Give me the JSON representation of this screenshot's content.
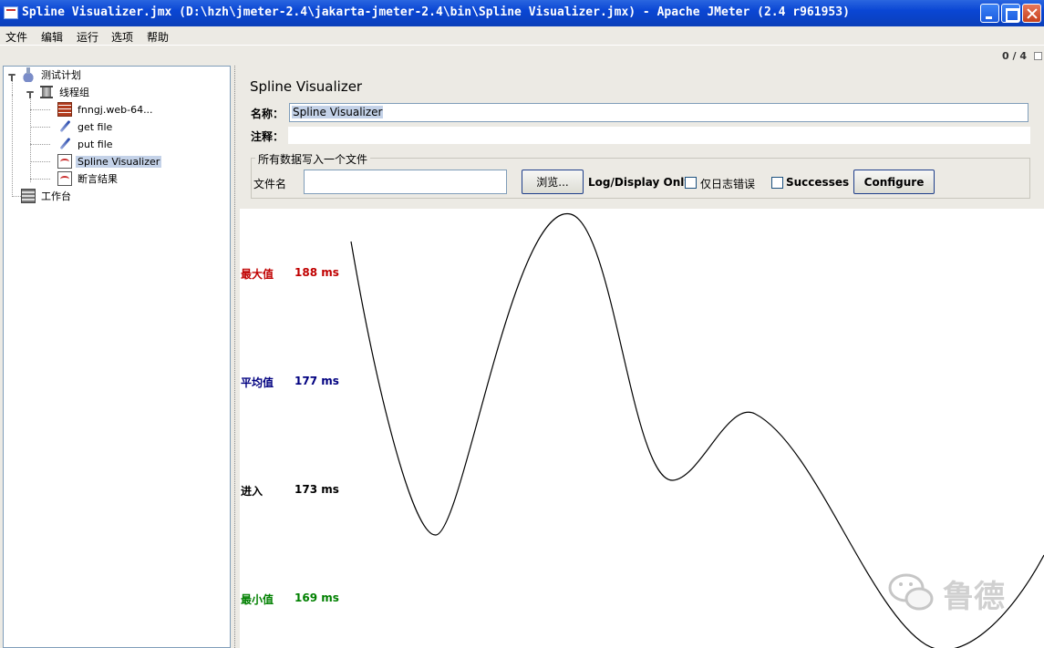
{
  "window": {
    "title": "Spline Visualizer.jmx (D:\\hzh\\jmeter-2.4\\jakarta-jmeter-2.4\\bin\\Spline Visualizer.jmx) - Apache JMeter (2.4 r961953)"
  },
  "menu": [
    "文件",
    "编辑",
    "运行",
    "选项",
    "帮助"
  ],
  "toolbar": {
    "counter": "0 / 4"
  },
  "tree": {
    "items": [
      {
        "label": "测试计划",
        "icon": "flask-icon"
      },
      {
        "label": "线程组",
        "icon": "spool-icon"
      },
      {
        "label": "fnngj.web-64...",
        "icon": "bricks-icon"
      },
      {
        "label": "get file",
        "icon": "dropper-icon"
      },
      {
        "label": "put file",
        "icon": "dropper-icon"
      },
      {
        "label": "Spline Visualizer",
        "icon": "chart-icon",
        "selected": true
      },
      {
        "label": "断言结果",
        "icon": "chart-icon"
      },
      {
        "label": "工作台",
        "icon": "workbench-icon"
      }
    ]
  },
  "panel": {
    "title": "Spline Visualizer",
    "name_label": "名称：",
    "name_value": "Spline Visualizer",
    "comment_label": "注释：",
    "file_group_title": "所有数据写入一个文件",
    "filename_label": "文件名",
    "filename_value": "",
    "browse_button": "浏览...",
    "log_display_label": "Log/Display Only:",
    "errors_label": "仅日志错误",
    "errors_checked": false,
    "successes_label": "Successes",
    "successes_checked": false,
    "configure_button": "Configure"
  },
  "stats": [
    {
      "label": "最大值",
      "value": "188 ms",
      "color": "#c00000"
    },
    {
      "label": "平均值",
      "value": "177 ms",
      "color": "#000080"
    },
    {
      "label": "进入",
      "value": "173 ms",
      "color": "#000000"
    },
    {
      "label": "最小值",
      "value": "169 ms",
      "color": "#008000"
    }
  ],
  "watermark": {
    "text": "鲁德"
  }
}
